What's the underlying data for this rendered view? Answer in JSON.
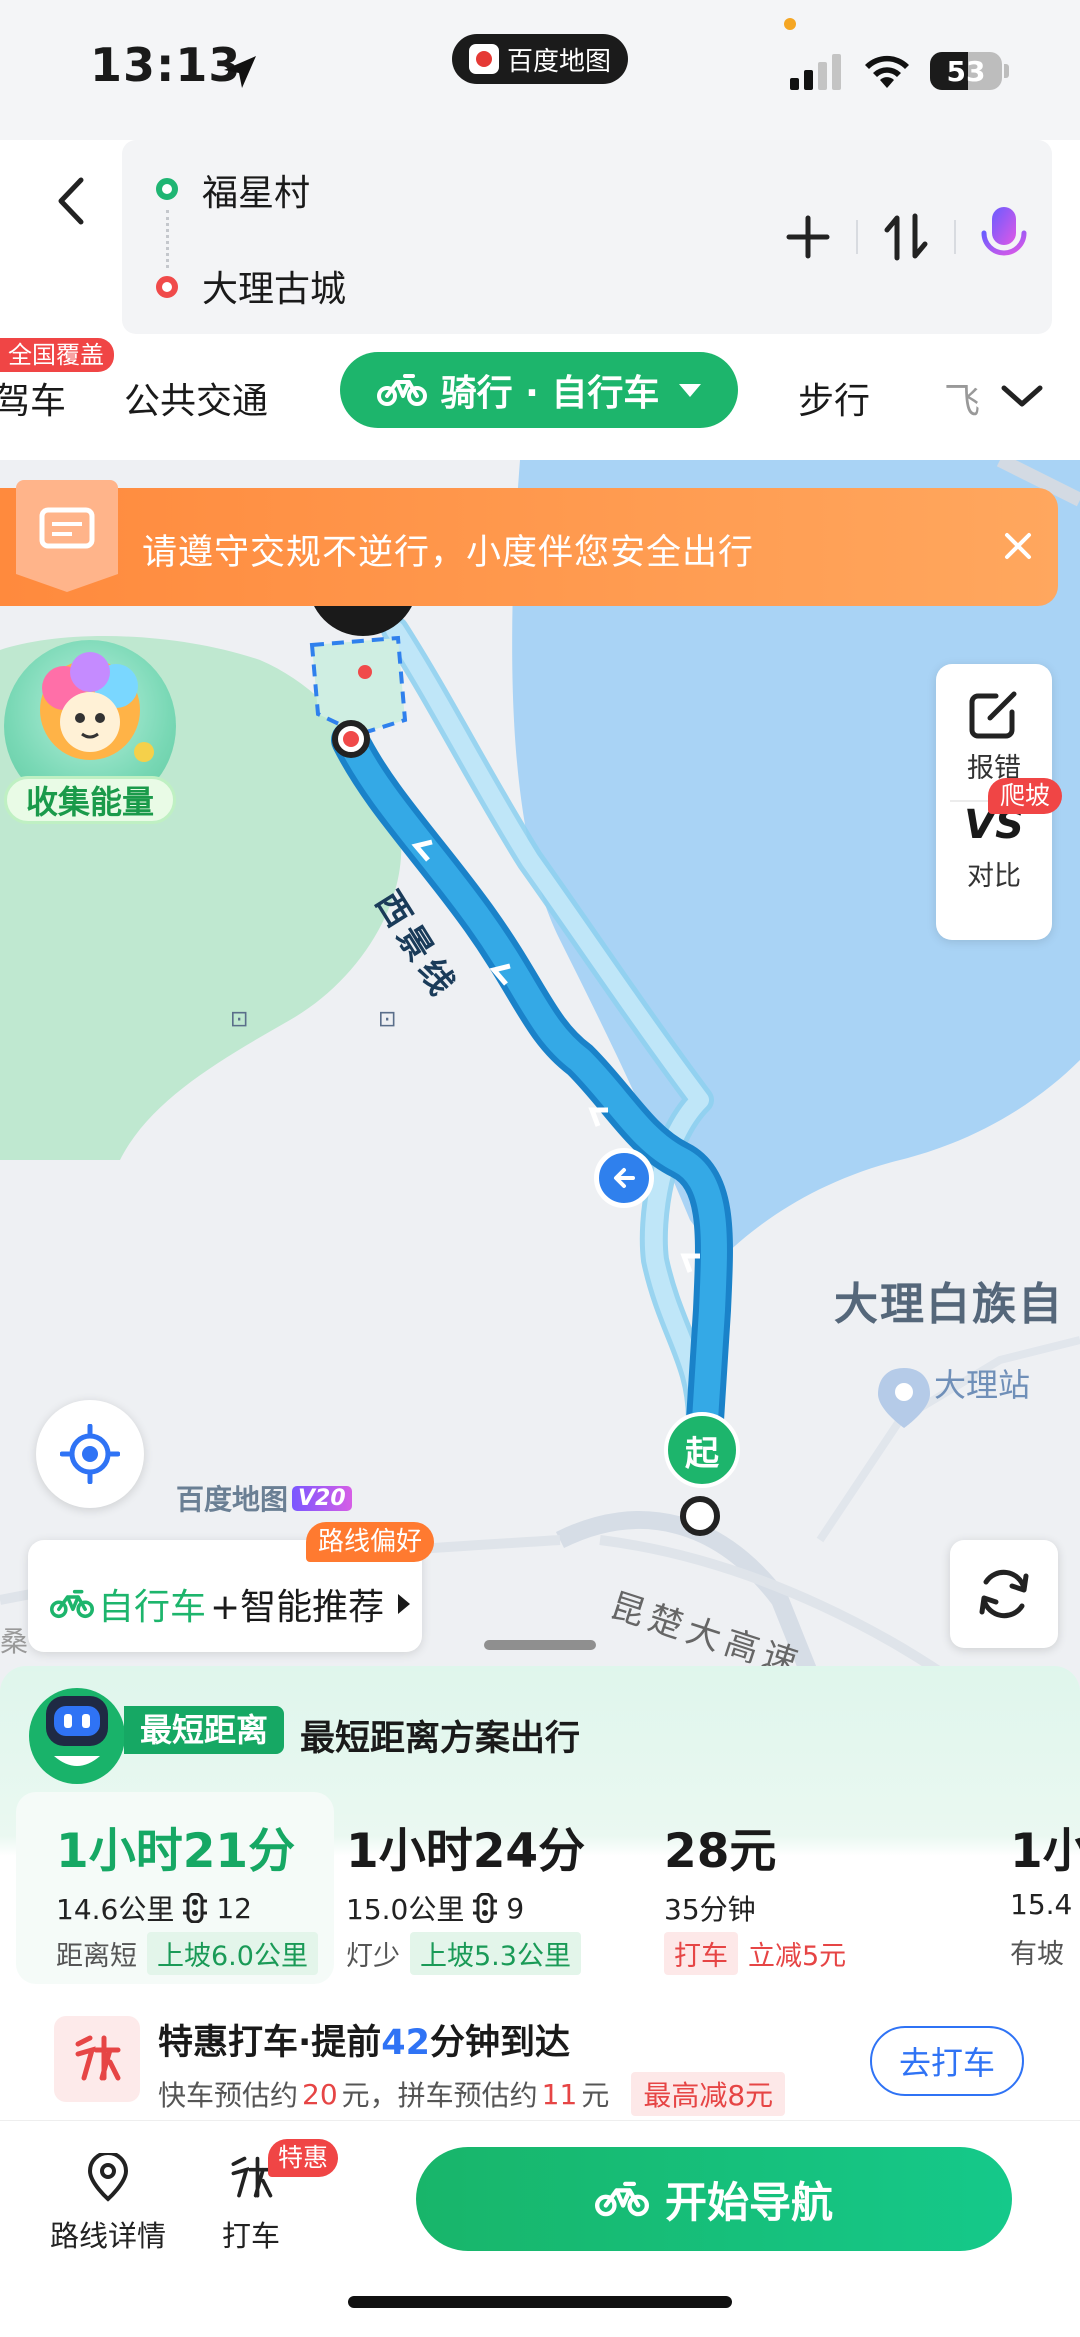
{
  "status_bar": {
    "time": "13:13",
    "app_pill": "百度地图",
    "battery": "53",
    "battery_level": 0.53
  },
  "header": {
    "start": "福星村",
    "end": "大理古城"
  },
  "mode_tabs": {
    "national_tag": "全国覆盖",
    "drive_partial": "驾车",
    "transit": "公共交通",
    "active": "骑行 · 自行车",
    "walk": "步行",
    "more_partial": "飞"
  },
  "notice": {
    "text": "请遵守交规不逆行，小度伴您安全出行"
  },
  "map": {
    "road_label": "西景线",
    "region_label": "大理白族自",
    "station_label": "大理站",
    "highway_label": "昆楚大高速",
    "left_edge_label": "桑"
  },
  "start_marker": "起",
  "mascot_label": "收集能量",
  "side_panel": {
    "report": "报错",
    "compare_vs": "VS",
    "compare": "对比",
    "compare_badge": "爬坡"
  },
  "brand": {
    "name": "百度地图",
    "version": "V20"
  },
  "bike_pref": {
    "prefix": "自行车",
    "suffix": "+智能推荐",
    "badge": "路线偏好"
  },
  "sheet": {
    "badge": "最短距离",
    "title": "最短距离方案出行",
    "options": [
      {
        "time": "1小时21分",
        "distance": "14.6公里",
        "lights": "12",
        "tag_plain": "距离短",
        "tag_green": "上坡6.0公里"
      },
      {
        "time": "1小时24分",
        "distance": "15.0公里",
        "lights": "9",
        "tag_plain": "灯少",
        "tag_green": "上坡5.3公里"
      },
      {
        "time": "28元",
        "distance": "35分钟",
        "tag_red": "打车",
        "tag_red_text": "立减5元"
      },
      {
        "time": "1小",
        "distance": "15.4",
        "tag_plain": "有坡"
      }
    ],
    "taxi": {
      "title_prefix": "特惠打车·提前",
      "minutes": "42",
      "title_suffix": "分钟到达",
      "sub_1": "快车预估约",
      "price_fast": "20",
      "sub_2": "元，拼车预估约",
      "price_pool": "11",
      "sub_3": "元",
      "discount": "最高减8元",
      "button": "去打车"
    }
  },
  "bottom_bar": {
    "route_detail": "路线详情",
    "taxi": "打车",
    "taxi_badge": "特惠",
    "start_nav": "开始导航"
  }
}
